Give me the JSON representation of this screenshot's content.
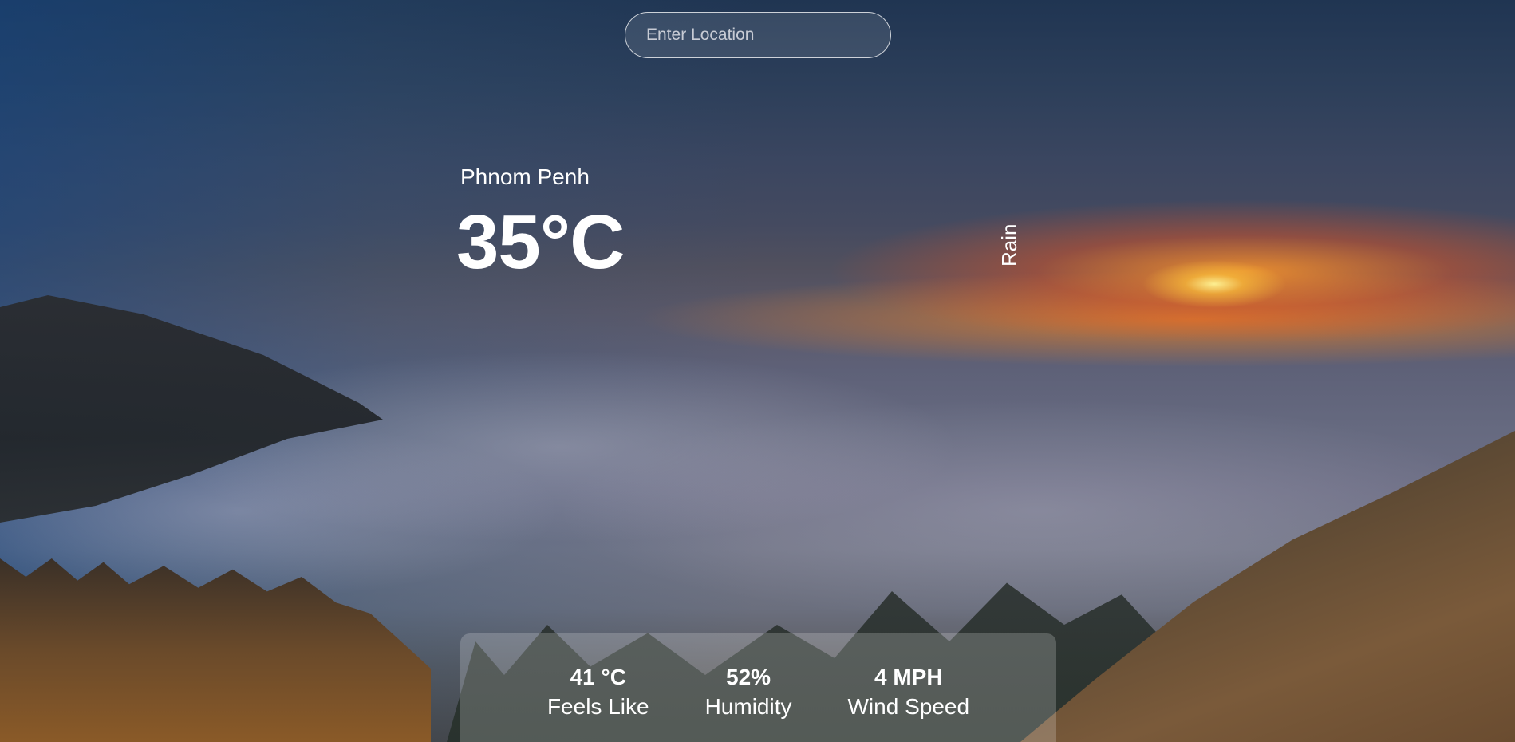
{
  "search": {
    "placeholder": "Enter Location",
    "value": ""
  },
  "weather": {
    "location": "Phnom Penh",
    "temperature": "35°C",
    "description": "Rain"
  },
  "stats": [
    {
      "value": "41 °C",
      "label": "Feels Like"
    },
    {
      "value": "52%",
      "label": "Humidity"
    },
    {
      "value": "4 MPH",
      "label": "Wind Speed"
    }
  ]
}
